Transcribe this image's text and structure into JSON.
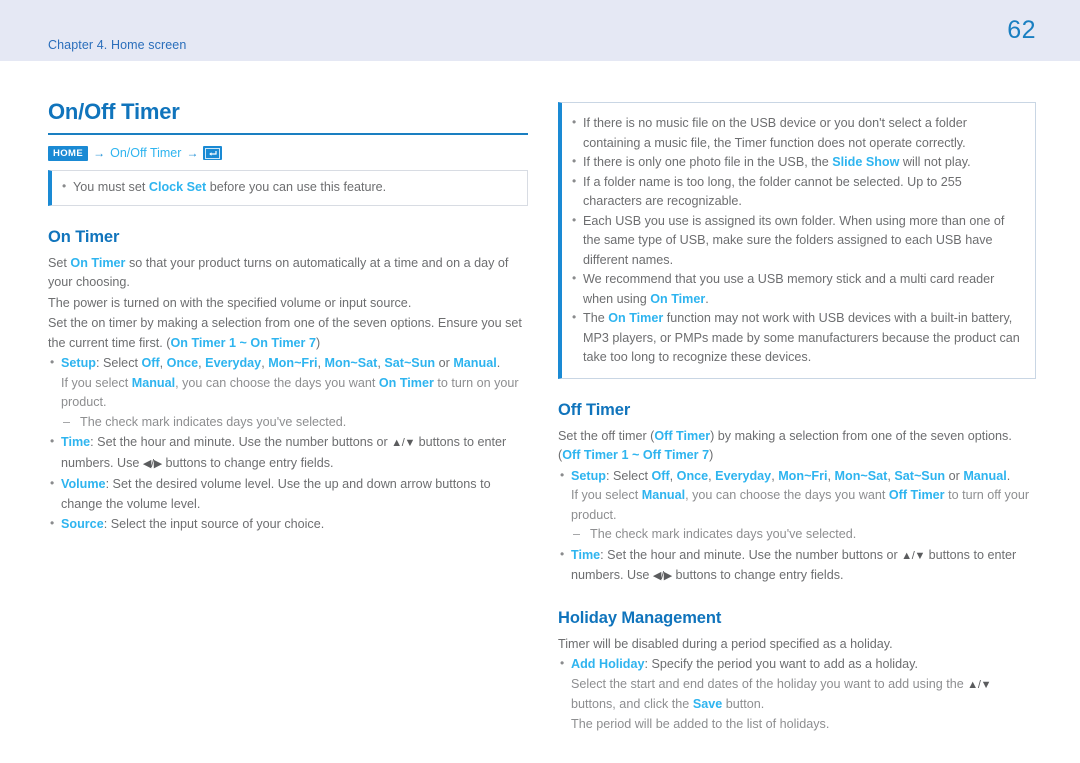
{
  "header": {
    "chapter": "Chapter 4. Home screen",
    "page_number": "62",
    "bar_color": "#e5e8f4",
    "text_color": "#2a6ebb"
  },
  "colors": {
    "heading_blue": "#1074bc",
    "link_blue": "#2eb4ef",
    "rule_blue": "#1a7fc1",
    "badge_blue": "#1a8ad4",
    "body_gray": "#6d6e70"
  },
  "left_column": {
    "title": "On/Off Timer",
    "breadcrumb": {
      "home_label": "HOME",
      "arrow": "→",
      "path_label": "On/Off Timer",
      "enter_icon": "enter-key-icon"
    },
    "note": {
      "text_before": "You must set ",
      "link": "Clock Set",
      "text_after": " before you can use this feature."
    },
    "section": {
      "title": "On Timer",
      "p1_a": "Set ",
      "p1_link": "On Timer",
      "p1_b": " so that your product turns on automatically at a time and on a day of your choosing.",
      "p2": "The power is turned on with the specified volume or input source.",
      "p3_a": "Set the on timer by making a selection from one of the seven options. Ensure you set the current time first. (",
      "p3_link1": "On Timer 1",
      "p3_mid": " ~ ",
      "p3_link2": "On Timer 7",
      "p3_b": ")",
      "bullets": [
        {
          "label": "Setup",
          "sep": ": Select ",
          "options": [
            "Off",
            "Once",
            "Everyday",
            "Mon~Fri",
            "Mon~Sat",
            "Sat~Sun"
          ],
          "or_word": " or ",
          "last_option": "Manual",
          "period": ".",
          "sub_a": "If you select ",
          "sub_link1": "Manual",
          "sub_b": ", you can choose the days you want ",
          "sub_link2": "On Timer",
          "sub_c": " to turn on your product.",
          "dash": "The check mark indicates days you've selected."
        },
        {
          "label": "Time",
          "text_a": ": Set the hour and minute. Use the number buttons or ",
          "arrows_1": "▲/▼",
          "text_b": " buttons to enter numbers. Use ",
          "arrows_2": "◀/▶",
          "text_c": " buttons to change entry fields."
        },
        {
          "label": "Volume",
          "text": ": Set the desired volume level. Use the up and down arrow buttons to change the volume level."
        },
        {
          "label": "Source",
          "text": ": Select the input source of your choice."
        }
      ]
    }
  },
  "right_column": {
    "note_box": {
      "items": [
        {
          "text": "If there is no music file on the USB device or you don't select a folder containing a music file, the Timer function does not operate correctly."
        },
        {
          "text_a": "If there is only one photo file in the USB, the ",
          "link": "Slide Show",
          "text_b": " will not play."
        },
        {
          "text": "If a folder name is too long, the folder cannot be selected. Up to 255 characters are recognizable."
        },
        {
          "text": "Each USB you use is assigned its own folder. When using more than one of the same type of USB, make sure the folders assigned to each USB have different names."
        },
        {
          "text_a": "We recommend that you use a USB memory stick and a multi card reader when using ",
          "link": "On Timer",
          "text_b": "."
        },
        {
          "text_a": "The ",
          "link": "On Timer",
          "text_b": " function may not work with USB devices with a built-in battery, MP3 players, or PMPs made by some manufacturers because the product can take too long to recognize these devices."
        }
      ]
    },
    "off_timer": {
      "title": "Off Timer",
      "p1_a": "Set the off timer (",
      "p1_link1": "Off Timer",
      "p1_b": ") by making a selection from one of the seven options. (",
      "p1_link2": "Off Timer 1",
      "p1_mid": " ~ ",
      "p1_link3": "Off Timer 7",
      "p1_c": ")",
      "bullets": [
        {
          "label": "Setup",
          "sep": ": Select ",
          "options": [
            "Off",
            "Once",
            "Everyday",
            "Mon~Fri",
            "Mon~Sat",
            "Sat~Sun"
          ],
          "or_word": " or ",
          "last_option": "Manual",
          "period": ".",
          "sub_a": "If you select ",
          "sub_link1": "Manual",
          "sub_b": ", you can choose the days you want ",
          "sub_link2": "Off Timer",
          "sub_c": " to turn off your product.",
          "dash": "The check mark indicates days you've selected."
        },
        {
          "label": "Time",
          "text_a": ": Set the hour and minute. Use the number buttons or ",
          "arrows_1": "▲/▼",
          "text_b": " buttons to enter numbers. Use ",
          "arrows_2": "◀/▶",
          "text_c": " buttons to change entry fields."
        }
      ]
    },
    "holiday": {
      "title": "Holiday Management",
      "p1": "Timer will be disabled during a period specified as a holiday.",
      "bullet": {
        "label": "Add Holiday",
        "text": ": Specify the period you want to add as a holiday.",
        "sub_a": "Select the start and end dates of the holiday you want to add using the ",
        "arrows": "▲/▼",
        "sub_b": " buttons, and click the ",
        "sub_link": "Save",
        "sub_c": " button.",
        "sub_d": "The period will be added to the list of holidays."
      }
    }
  }
}
